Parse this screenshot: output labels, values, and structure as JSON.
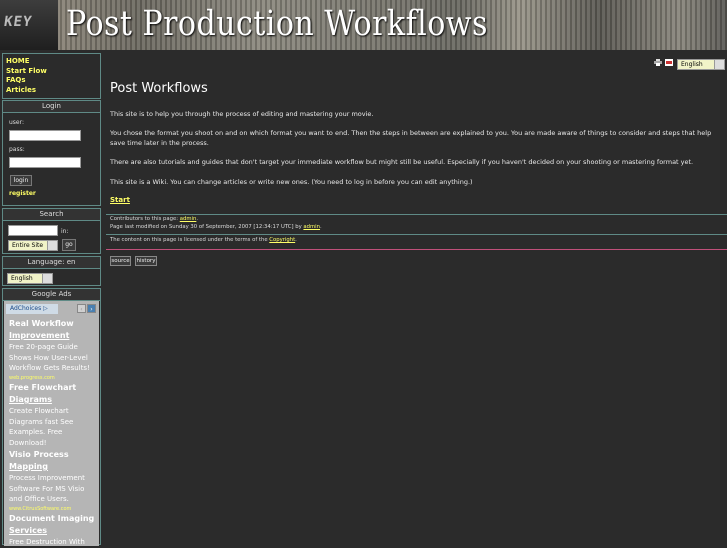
{
  "site": {
    "title": "Post Production Workflows"
  },
  "nav": {
    "items": [
      "HOME",
      "Start Flow",
      "FAQs",
      "Articles"
    ]
  },
  "login": {
    "title": "Login",
    "user_label": "user:",
    "pass_label": "pass:",
    "login_button": "login",
    "register_link": "register"
  },
  "search": {
    "title": "Search",
    "in_label": "in:",
    "scope_selected": "Entire Site",
    "go_button": "go"
  },
  "language_box": {
    "title": "Language: en",
    "selected": "English"
  },
  "ads_box": {
    "title": "Google Ads",
    "adchoices": "AdChoices ▷",
    "ads": [
      {
        "title_line1": "Real Workflow",
        "title_line2": "Improvement",
        "body": "Free 20-page Guide Shows How User-Level Workflow Gets Results!",
        "url": "web.progress.com"
      },
      {
        "title_line1": "Free Flowchart",
        "title_line2": "Diagrams",
        "body": "Create Flowchart Diagrams fast See Examples. Free Download!",
        "url": ""
      },
      {
        "title_line1": "Visio Process",
        "title_line2": "Mapping",
        "body": "Process Improvement Software For MS Visio and Office Users.",
        "url": "www.CitrusSoftware.com"
      },
      {
        "title_line1": "Document Imaging",
        "title_line2": "Services",
        "body": "Free Destruction With",
        "url": ""
      }
    ]
  },
  "main": {
    "language_selected": "English",
    "page_title": "Post Workflows",
    "paragraphs": [
      "This site is to help you through the process of editing and mastering your movie.",
      "You chose the format you shoot on and on which format you want to end. Then the steps in between are explained to you. You are made aware of things to consider and steps that help save time later in the process.",
      "There are also tutorials and guides that don't target your immediate workflow but might still be useful. Especially if you haven't decided on your shooting or mastering format yet.",
      "This site is a Wiki. You can change articles or write new ones. (You need to log in before you can edit anything.)"
    ],
    "start_link": "Start",
    "contributors_label": "Contributors to this page:",
    "contributors_user": "admin",
    "contributors_end": ".",
    "modified_label": "Page last modified on Sunday 30 of September, 2007 [12:34:17 UTC] by",
    "modified_user": "admin",
    "modified_end": ".",
    "license_text": "The content on this page is licensed under the terms of the",
    "license_link": "Copyright",
    "license_end": ".",
    "source_button": "source",
    "history_button": "history"
  },
  "colors": {
    "background": "#2b2b2b",
    "link": "#ffff66",
    "box_border": "#5f8a86",
    "license_rule": "#c0507a"
  },
  "icons": [
    "print-icon",
    "pdf-icon"
  ]
}
